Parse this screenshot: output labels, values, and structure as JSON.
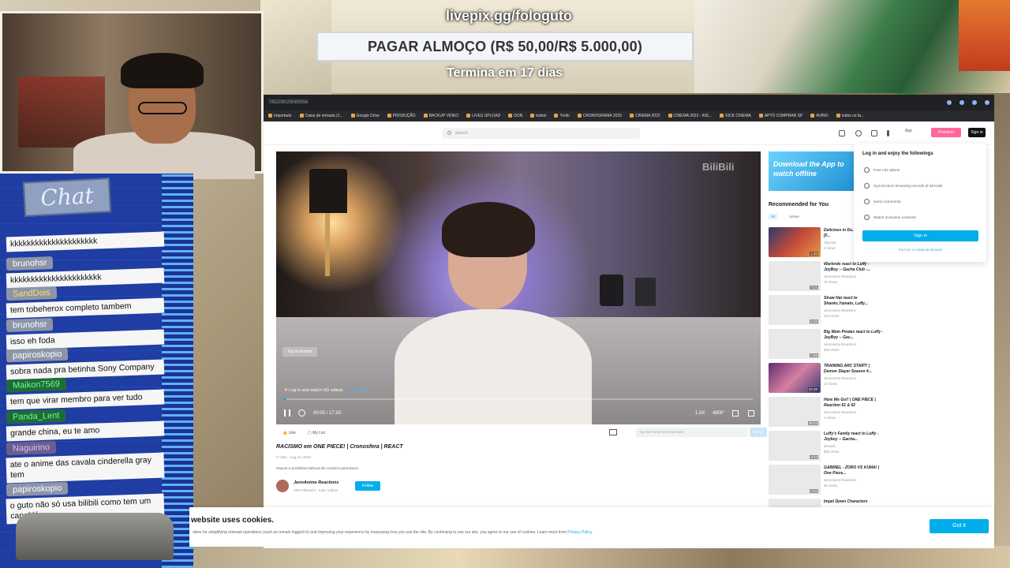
{
  "overlay": {
    "url": "livepix.gg/fologuto",
    "goal": "PAGAR ALMOÇO (R$ 50,00/R$ 5.000,00)",
    "ends": "Termina em 17 dias"
  },
  "chat": {
    "title": "Chat",
    "messages": [
      {
        "user": "",
        "text": "kkkkkkkkkkkkkkkkkkkkk"
      },
      {
        "user": "brunohsr",
        "text": "kkkkkkkkkkkkkkkkkkkkkk"
      },
      {
        "user": "SandDois",
        "text": "tem tobeherox completo tambem"
      },
      {
        "user": "brunohsr",
        "text": "isso eh foda"
      },
      {
        "user": "papiroskopio",
        "text": "sobra nada pra betinha Sony Company"
      },
      {
        "user": "Maikon7569",
        "text": "tem que virar membro para ver tudo"
      },
      {
        "user": "Panda_Lent",
        "text": "grande china, eu te amo"
      },
      {
        "user": "Naguirino",
        "text": "ate o anime das cavala cinderella gray tem"
      },
      {
        "user": "papiroskopio",
        "text": "o guto não só usa bilibili como tem um canal lá"
      }
    ]
  },
  "browser": {
    "url": "785209025085958",
    "bookmarks": [
      "Importado",
      "Caixa de entrada (1...",
      "Google Drive",
      "PRODUÇÃO",
      "BACKUP VIDEO",
      "LIVES UPLOAD",
      "DON",
      "kobini",
      "Trello",
      "CRONOGRAMA 2025",
      "CINEMA 2022",
      "CINEMA 2023 - INS...",
      "KICK CINEMA",
      "APTO COMPRAR SP",
      "AVINO",
      "todos os fa..."
    ]
  },
  "site": {
    "search_placeholder": "Search",
    "app_label": "App",
    "premium_label": "Premium",
    "signin_label": "Sign in"
  },
  "player": {
    "watermark": "BiliBili",
    "tap_unmute": "Tap to unmute",
    "login_notice": "Log in and watch HD videos",
    "login_link": "Log in Now",
    "time": "00:02 / 17:33",
    "speed": "1.0X",
    "quality": "480P",
    "progress": 0.002
  },
  "actions": {
    "like": "Like",
    "mylist": "My List",
    "danmaku_placeholder": "Tap here and send danmaku",
    "send": "Send"
  },
  "video": {
    "title": "RACISMO em ONE PIECE! | Cronosfera | REACT",
    "meta": "0 View · Aug 24, 2023",
    "repost": "Repost is prohibited without the creator's permission",
    "uploader": "JennAnime Reactions",
    "uploader_stats": "259 Followers · 6.8K Videos",
    "follow": "Follow"
  },
  "sidebar": {
    "app_banner": "Download the App to watch offline",
    "recommended": "Recommended for You",
    "tabs": [
      "All",
      "Anime"
    ],
    "items": [
      {
        "title": "Delicious in Du... [Episode 10] [F...",
        "author": "SkyAnat",
        "views": "4 Views",
        "duration": "1:32"
      },
      {
        "title": "Warlords react to Luffy - JoyBoy -- Gacha Club -...",
        "author": "JennAnime Reactions",
        "views": "76 Views",
        "duration": "7:21"
      },
      {
        "title": "Straw Hat react to Shanks,Yamato, Luffy...",
        "author": "JennAnime Reactions",
        "views": "304 Views",
        "duration": "6:59"
      },
      {
        "title": "Big Mom Pirates react to Luffy - JoyBoy -- Gac...",
        "author": "JennAnime Reactions",
        "views": "543 Views",
        "duration": "7:59"
      },
      {
        "title": "TRAINING ARC START! | Demon Slayer Season 4...",
        "author": "JennAnime Reactions",
        "views": "14 Views",
        "duration": "24:39"
      },
      {
        "title": "Here We Go!! | ONE PIECE | Reaction 61 & 62",
        "author": "JennAnime Reactions",
        "views": "1 Views",
        "duration": "38:54"
      },
      {
        "title": "Luffy's Family react to Luffy - Joyboy -- Gacha...",
        "author": "ahmad1",
        "views": "850 Views",
        "duration": "3:44"
      },
      {
        "title": "GABRIEL - ZORO VS KUMA! | One Piece...",
        "author": "JennAnime Reactions",
        "views": "65 Views",
        "duration": "3:53"
      },
      {
        "title": "Impel Down Characters",
        "author": "",
        "views": "",
        "duration": ""
      }
    ]
  },
  "login_popup": {
    "heading": "Log in and enjoy the followings",
    "features": [
      "Free HD videos",
      "Synchronize browsing records of all ends",
      "Send comments",
      "Watch exclusive contents"
    ],
    "button": "Sign in",
    "register_prefix": "Tap here to",
    "register_link": "create an account"
  },
  "cookie": {
    "title": "website uses cookies.",
    "text": "okies for simplifying relevant operations (such as remain logged in) and improving your experience by measuring how you use the site. By continuing to use our site, you agree to our use of cookies. Learn more from",
    "link": "Privacy Policy",
    "button": "Got it"
  }
}
